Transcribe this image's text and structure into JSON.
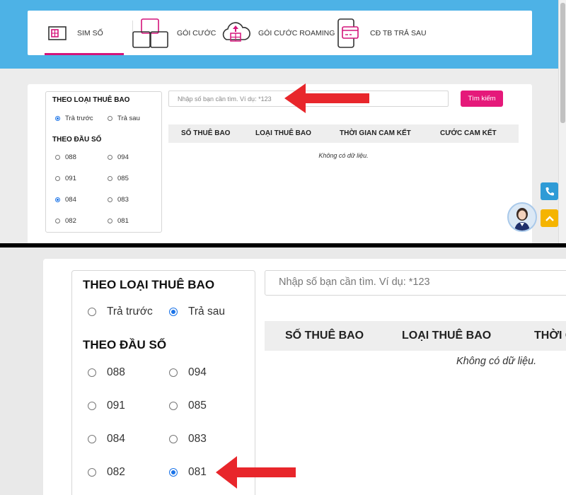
{
  "tabs": [
    {
      "label": "SIM SỐ",
      "icon": "sim-card-icon",
      "active": true
    },
    {
      "label": "GÓI CƯỚC",
      "icon": "package-boxes-icon",
      "active": false
    },
    {
      "label": "GÓI CƯỚC ROAMING",
      "icon": "cloud-roaming-icon",
      "active": false
    },
    {
      "label": "CĐ TB TRẢ SAU",
      "icon": "postpaid-card-icon",
      "active": false
    }
  ],
  "filter": {
    "subscriber_type_title": "THEO LOẠI THUÊ BAO",
    "subscriber_types": [
      "Trả trước",
      "Trả sau"
    ],
    "prefix_title": "THEO ĐẦU SỐ",
    "prefixes": [
      "088",
      "094",
      "091",
      "085",
      "084",
      "083",
      "082",
      "081"
    ]
  },
  "top_panel": {
    "selected_subscriber_type": "Trả trước",
    "selected_prefix": "084"
  },
  "bottom_panel": {
    "selected_subscriber_type": "Trả sau",
    "selected_prefix": "081"
  },
  "search": {
    "placeholder": "Nhập số bạn cần tìm. Ví dụ: *123",
    "button_label": "Tìm kiếm"
  },
  "table": {
    "columns": [
      "SỐ THUÊ BAO",
      "LOẠI THUÊ BAO",
      "THỜI GIAN CAM KẾT",
      "CƯỚC CAM KẾT"
    ],
    "empty_text": "Không có dữ liệu."
  },
  "colors": {
    "brand_blue": "#4db2e6",
    "accent_pink": "#e5197a",
    "arrow_red": "#e8262b",
    "radio_selected": "#1a73e8"
  }
}
